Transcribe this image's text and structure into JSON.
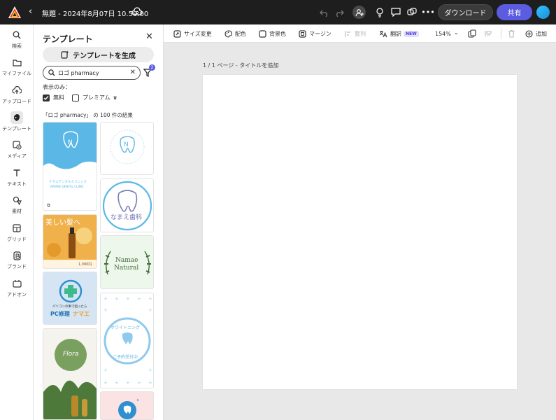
{
  "topbar": {
    "title": "無題 - 2024年8月07日 10.59.00",
    "download_label": "ダウンロード",
    "share_label": "共有",
    "icons": [
      "adobe-express-logo",
      "back-chevron-icon",
      "cloud-sync-icon",
      "undo-icon",
      "redo-icon",
      "invite-user-icon",
      "lightbulb-icon",
      "comment-icon",
      "share-link-icon",
      "more-icon"
    ]
  },
  "rail": {
    "items": [
      {
        "label": "検索",
        "icon": "search-icon"
      },
      {
        "label": "マイファイル",
        "icon": "folder-icon"
      },
      {
        "label": "アップロード",
        "icon": "upload-icon"
      },
      {
        "label": "テンプレート",
        "icon": "template-icon",
        "active": true
      },
      {
        "label": "メディア",
        "icon": "media-icon"
      },
      {
        "label": "テキスト",
        "icon": "text-icon"
      },
      {
        "label": "素材",
        "icon": "shapes-icon"
      },
      {
        "label": "グリッド",
        "icon": "grid-icon"
      },
      {
        "label": "ブランド",
        "icon": "brand-icon"
      },
      {
        "label": "アドオン",
        "icon": "addon-icon"
      }
    ]
  },
  "panel": {
    "title": "テンプレート",
    "generate_label": "テンプレートを生成",
    "search_value": "ロゴ pharmacy",
    "filter_count": "2",
    "show_only": "表示のみ：",
    "free_label": "無料",
    "premium_label": "プレミアム",
    "results": "「ロゴ pharmacy」 の 100 件の結果",
    "templates": {
      "t1_name": "ナマエデンタルクリニック",
      "t1_sub": "NAMAE DENTAL CLINIC",
      "t1_letter": "N",
      "t3_text": "なまえ歯科",
      "t4_text": "美しい髪へ",
      "t4_price": "1,000円",
      "t5_name": "Namae",
      "t5_sub": "Natural",
      "t6_line1": "パソコンの事で困ったら",
      "t6_line2": "PC修理",
      "t6_line3": "ナマエ",
      "t7_text": "ホワイトニング",
      "t7_sub": "ご予約受付中",
      "t8_name": "Flora"
    }
  },
  "toolbar": {
    "resize": "サイズ変更",
    "color": "配色",
    "bg_color": "背景色",
    "margin": "マージン",
    "align": "整列",
    "translate": "翻訳",
    "new_badge": "NEW",
    "zoom": "154%",
    "add": "追加"
  },
  "canvas": {
    "page_label": "1 / 1 ページ - タイトルを追加"
  },
  "colors": {
    "topbar": "#1e1e1e",
    "accent": "#5c5ce0",
    "dental_blue": "#5bb8e6"
  }
}
